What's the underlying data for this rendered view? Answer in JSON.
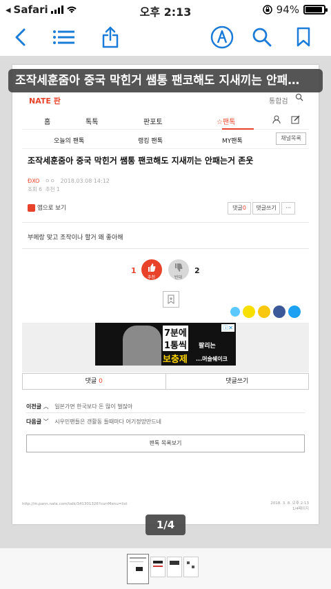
{
  "status": {
    "carrier": "Safari",
    "time": "오후 2:13",
    "battery_text": "94%",
    "battery_level": 0.94
  },
  "toolbar": {
    "icons": [
      "back-chevron-icon",
      "list-icon",
      "share-icon",
      "markup-pen-icon",
      "search-icon",
      "bookmark-icon"
    ],
    "accent": "#1a7bd8"
  },
  "document": {
    "banner_title": "조작세훈줌아 중국 막힌거 쌤통 팬코해도 지새끼는 안패…",
    "page": {
      "logo": "NATE 판",
      "header_right": "통합검",
      "nav1": [
        "홈",
        "톡톡",
        "판포토",
        "☆팬톡"
      ],
      "nav2": [
        "오늘의 팬톡",
        "랭킹 팬톡",
        "MY팬톡"
      ],
      "channel_button": "채널목록",
      "post_title": "조작세훈줌아 중국 막힌거 쌤통 팬코해도 지새끼는 안패는거 존웃",
      "author": "ĐXO",
      "meta_mid": "ㅇㅇ",
      "date": "2018.03.08 14:12",
      "views": "조회 6",
      "recommend": "추천 1",
      "app_view": "앱으로 보기",
      "comment_label": "댓글",
      "comment_count": "0",
      "write_comment": "댓글쓰기",
      "more": "···",
      "body": "부메랑 맞고 조작이나 할거 왜 좋아해",
      "up_count": "1",
      "up_label": "추천",
      "down_count": "2",
      "down_label": "반대",
      "ad": {
        "line1": "7분에",
        "line2": "1통씩",
        "line3": "팔리는",
        "line4": "보충제",
        "line5": "...머슬쉐이크",
        "close": "ⓘ✕"
      },
      "tab_comments": "댓글",
      "tab_comments_count": "0",
      "tab_write": "댓글쓰기",
      "prev_label": "이전글",
      "prev_text": "일본가면 한국보다 돈 많이 벌잖아",
      "next_label": "다음글",
      "next_text": "시우민팬들은 갠활동 들때마다 어기정망만드네",
      "list_button": "팬톡 목록보기",
      "footer_url": "http://m.pann.nate.com/talk/341301326?currMenu=list",
      "footer_date": "2018. 3. 8. 오후 2:13",
      "footer_page": "1/4페이지"
    },
    "pager": "1/4"
  },
  "colors": {
    "nate_red": "#e8432a",
    "kakao": "#f7e000",
    "facebook": "#3b5998",
    "twitter": "#1da1f2"
  }
}
